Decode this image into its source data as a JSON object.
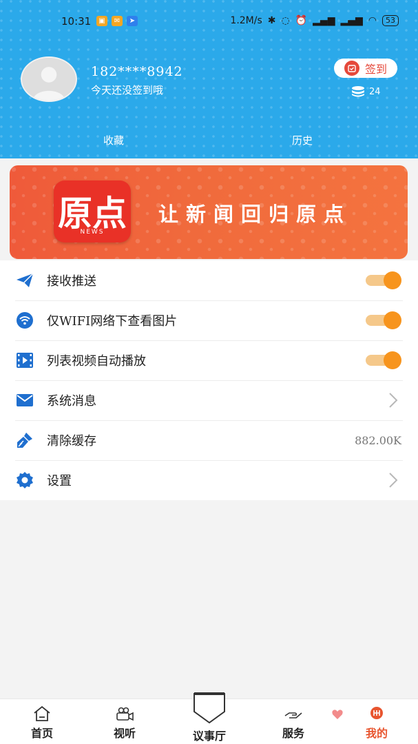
{
  "status_bar": {
    "time": "10:31",
    "net_speed": "1.2M/s",
    "battery": "53"
  },
  "profile": {
    "username": "182****8942",
    "sign_hint": "今天还没签到哦",
    "signin_label": "签到",
    "coins": "24"
  },
  "tabs": {
    "favorites": "收藏",
    "history": "历史"
  },
  "banner": {
    "logo_text": "原点",
    "logo_sub": "NEWS",
    "slogan": "让新闻回归原点"
  },
  "settings": [
    {
      "label": "接收推送",
      "control": "toggle",
      "on": true,
      "icon": "paper-plane-icon"
    },
    {
      "label": "仅WIFI网络下查看图片",
      "control": "toggle",
      "on": true,
      "icon": "wifi-icon"
    },
    {
      "label": "列表视频自动播放",
      "control": "toggle",
      "on": true,
      "icon": "video-icon"
    },
    {
      "label": "系统消息",
      "control": "chevron",
      "icon": "mail-icon"
    },
    {
      "label": "清除缓存",
      "control": "value",
      "value": "882.00K",
      "icon": "broom-icon"
    },
    {
      "label": "设置",
      "control": "chevron",
      "icon": "gear-icon"
    }
  ],
  "bottom_nav": [
    {
      "label": "首页",
      "icon": "home-icon"
    },
    {
      "label": "视听",
      "icon": "camera-icon"
    },
    {
      "label": "议事厅",
      "icon": "shield-icon"
    },
    {
      "label": "服务",
      "icon": "hand-icon"
    },
    {
      "label": "我的",
      "icon": "profile-icon",
      "active": true
    }
  ],
  "colors": {
    "header_blue": "#2ba9ea",
    "accent_orange": "#f7941d",
    "brand_red": "#e93127",
    "active_nav": "#e8552f",
    "icon_blue": "#1f6fcf"
  }
}
